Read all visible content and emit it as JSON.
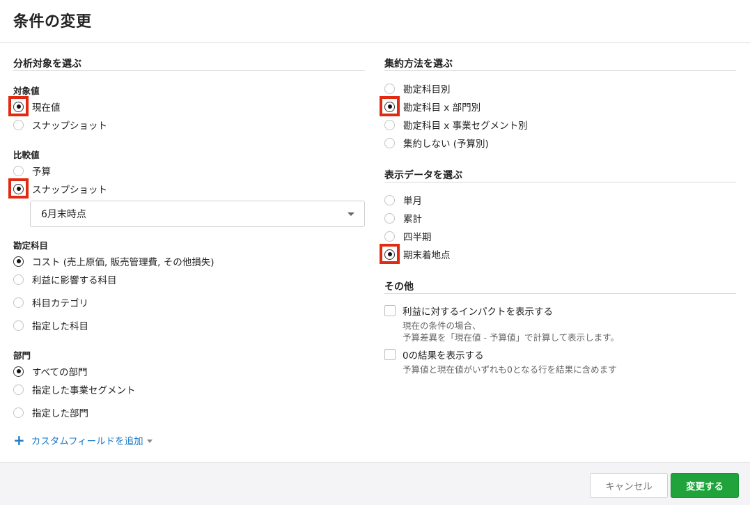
{
  "dialog": {
    "title": "条件の変更"
  },
  "left": {
    "section_title": "分析対象を選ぶ",
    "target": {
      "label": "対象値",
      "options": [
        {
          "label": "現在値",
          "checked": true
        },
        {
          "label": "スナップショット",
          "checked": false
        }
      ]
    },
    "compare": {
      "label": "比較値",
      "options": [
        {
          "label": "予算",
          "checked": false
        },
        {
          "label": "スナップショット",
          "checked": true
        }
      ],
      "snapshot_select": {
        "value": "6月末時点"
      }
    },
    "accounts": {
      "label": "勘定科目",
      "options": [
        {
          "label": "コスト (売上原価, 販売管理費, その他損失)",
          "checked": true
        },
        {
          "label": "利益に影響する科目",
          "checked": false
        },
        {
          "label": "科目カテゴリ",
          "checked": false
        },
        {
          "label": "指定した科目",
          "checked": false
        }
      ]
    },
    "departments": {
      "label": "部門",
      "options": [
        {
          "label": "すべての部門",
          "checked": true
        },
        {
          "label": "指定した事業セグメント",
          "checked": false
        },
        {
          "label": "指定した部門",
          "checked": false
        }
      ]
    },
    "add_custom_field": "カスタムフィールドを追加"
  },
  "right": {
    "aggregation": {
      "section_title": "集約方法を選ぶ",
      "options": [
        {
          "label": "勘定科目別",
          "checked": false
        },
        {
          "label": "勘定科目 x 部門別",
          "checked": true
        },
        {
          "label": "勘定科目 x 事業セグメント別",
          "checked": false
        },
        {
          "label": "集約しない (予算別)",
          "checked": false
        }
      ]
    },
    "display": {
      "section_title": "表示データを選ぶ",
      "options": [
        {
          "label": "単月",
          "checked": false
        },
        {
          "label": "累計",
          "checked": false
        },
        {
          "label": "四半期",
          "checked": false
        },
        {
          "label": "期末着地点",
          "checked": true
        }
      ]
    },
    "other": {
      "section_title": "その他",
      "impact": {
        "label": "利益に対するインパクトを表示する",
        "help_line1": "現在の条件の場合、",
        "help_line2": "予算差異を「現在値 - 予算値」で計算して表示します。"
      },
      "zero": {
        "label": "0の結果を表示する",
        "help": "予算値と現在値がいずれも0となる行を結果に含めます"
      }
    }
  },
  "footer": {
    "cancel_label": "キャンセル",
    "submit_label": "変更する"
  },
  "colors": {
    "highlight": "#e02a12",
    "primary": "#1fa33a",
    "link": "#1b7ac7"
  }
}
